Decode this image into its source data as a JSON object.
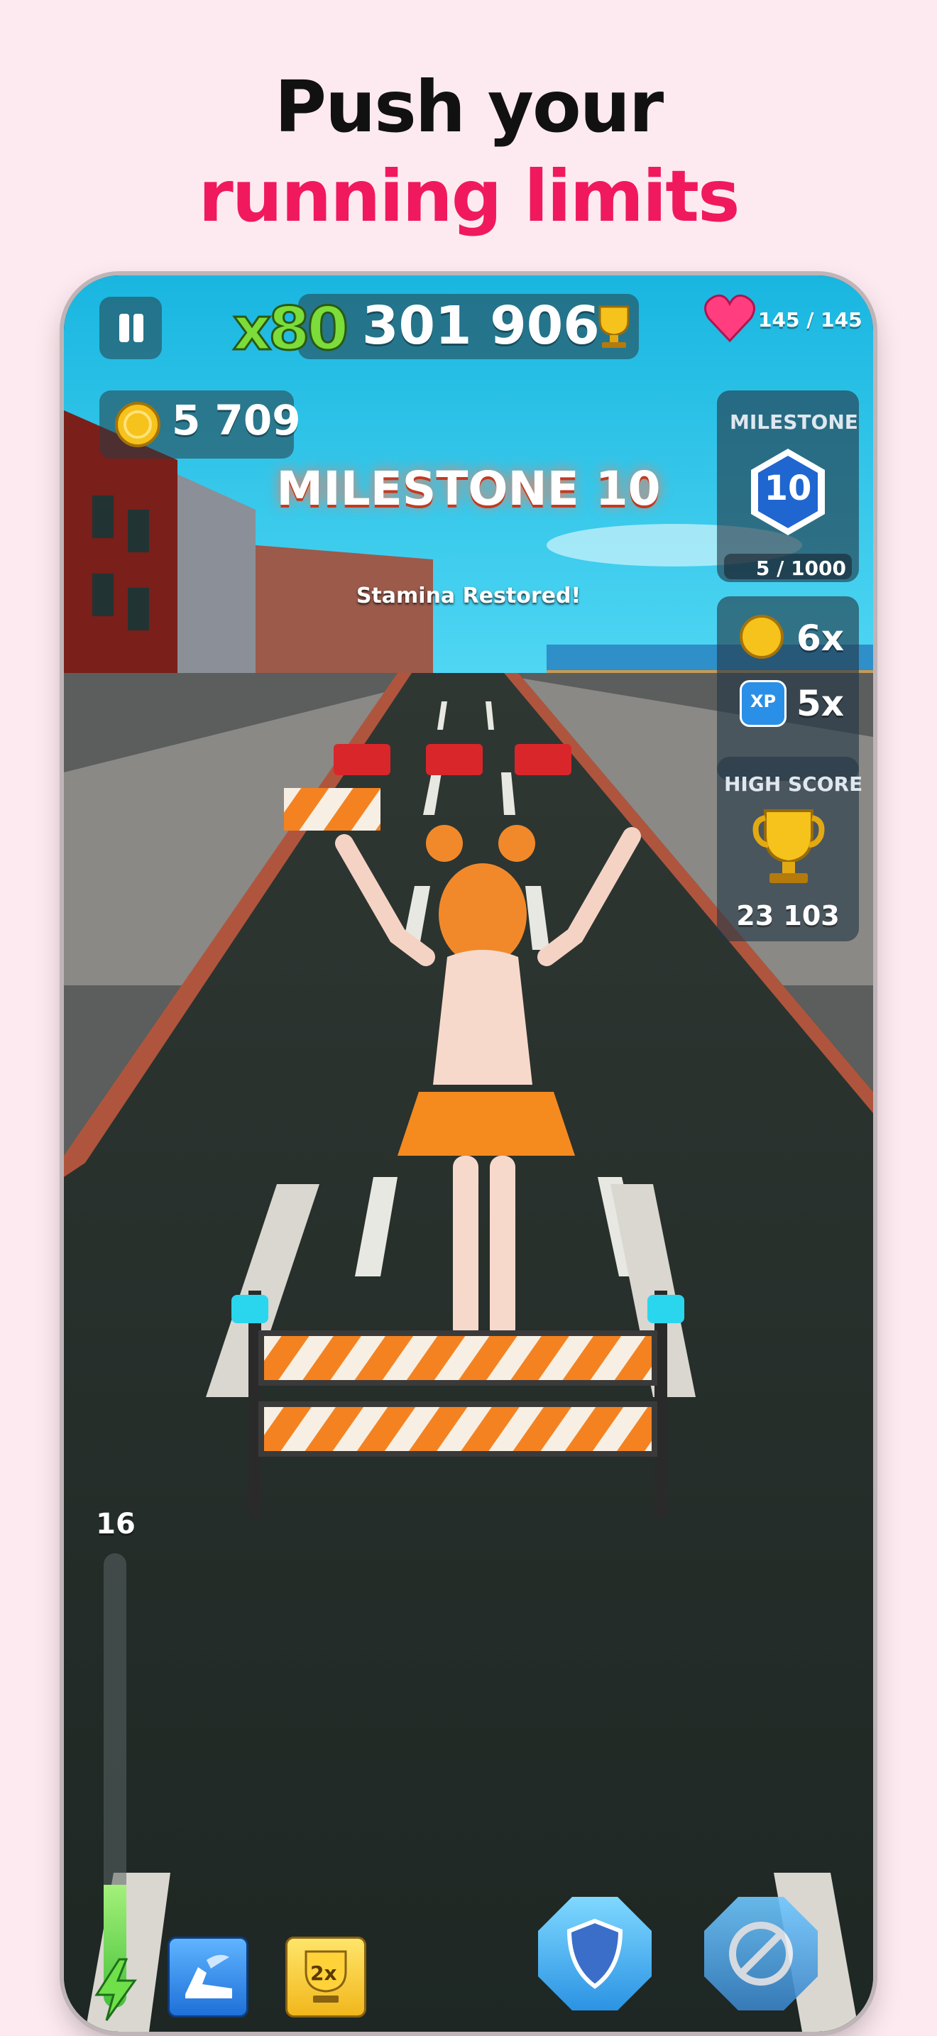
{
  "header": {
    "line1": "Push your",
    "line2": "running limits"
  },
  "hud": {
    "multiplier": "x80",
    "score": "301 906",
    "stamina": "145 / 145",
    "coins": "5 709",
    "milestone": {
      "label": "MILESTONE",
      "level": "10",
      "progress": "5 / 1000"
    },
    "coin_multiplier": "6x",
    "xp_badge": "XP",
    "xp_multiplier": "5x",
    "high_score": {
      "label": "HIGH SCORE",
      "value": "23 103"
    },
    "boost_level": "16",
    "boost_fill_fraction": 0.27,
    "powerup_double": "2x"
  },
  "banner": {
    "title": "MILESTONE 10",
    "message": "Stamina Restored!"
  },
  "colors": {
    "background": "#fdeaf0",
    "accent": "#f0195e",
    "sky": "#29c3e8",
    "road": "#222a26",
    "barrier_orange": "#f58220",
    "heart": "#ff3d7f"
  },
  "icons": [
    "pause-icon",
    "trophy-icon",
    "heart-icon",
    "coin-icon",
    "milestone-hex-icon",
    "xp-icon",
    "high-score-trophy-icon",
    "lightning-icon",
    "winged-shoe-icon",
    "double-trophy-icon",
    "shield-icon",
    "no-boost-icon"
  ]
}
